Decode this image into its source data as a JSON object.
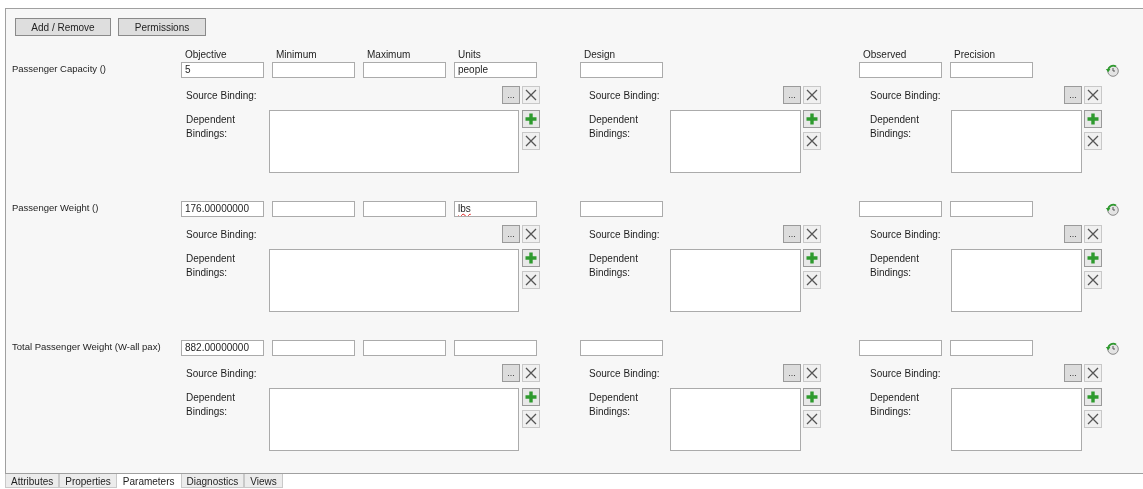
{
  "toolbar": {
    "buttons": [
      "Add / Remove",
      "Permissions"
    ]
  },
  "columns": [
    {
      "label": "Objective"
    },
    {
      "label": "Minimum"
    },
    {
      "label": "Maximum"
    },
    {
      "label": "Units"
    },
    {
      "label": "Design"
    },
    {
      "label": "Observed"
    },
    {
      "label": "Precision"
    }
  ],
  "parameters": [
    {
      "name": "Passenger Capacity ()",
      "objective": {
        "value": "5"
      },
      "units": {
        "value": "people"
      },
      "bindings": [
        {
          "source_label": "Source Binding:",
          "browse_button": "...",
          "dependent_label": "Dependent Bindings:"
        },
        {
          "source_label": "Source Binding:",
          "browse_button": "...",
          "dependent_label": "Dependent Bindings:"
        },
        {
          "source_label": "Source Binding:",
          "browse_button": "...",
          "dependent_label": "Dependent Bindings:"
        }
      ]
    },
    {
      "name": "Passenger Weight ()",
      "objective": {
        "value": "176.00000000"
      },
      "units": {
        "value": "lbs",
        "misspelled": true
      },
      "bindings": [
        {
          "source_label": "Source Binding:",
          "browse_button": "...",
          "dependent_label": "Dependent Bindings:"
        },
        {
          "source_label": "Source Binding:",
          "browse_button": "...",
          "dependent_label": "Dependent Bindings:"
        },
        {
          "source_label": "Source Binding:",
          "browse_button": "...",
          "dependent_label": "Dependent Bindings:"
        }
      ]
    },
    {
      "name": "Total Passenger Weight (W-all pax)",
      "objective": {
        "value": "882.00000000"
      },
      "bindings": [
        {
          "source_label": "Source Binding:",
          "browse_button": "...",
          "dependent_label": "Dependent Bindings:"
        },
        {
          "source_label": "Source Binding:",
          "browse_button": "...",
          "dependent_label": "Dependent Bindings:"
        },
        {
          "source_label": "Source Binding:",
          "browse_button": "...",
          "dependent_label": "Dependent Bindings:"
        }
      ]
    }
  ],
  "tabs": [
    {
      "label": "Attributes",
      "selected": false
    },
    {
      "label": "Properties",
      "selected": false
    },
    {
      "label": "Parameters",
      "selected": true
    },
    {
      "label": "Diagnostics",
      "selected": false
    },
    {
      "label": "Views",
      "selected": false
    }
  ]
}
